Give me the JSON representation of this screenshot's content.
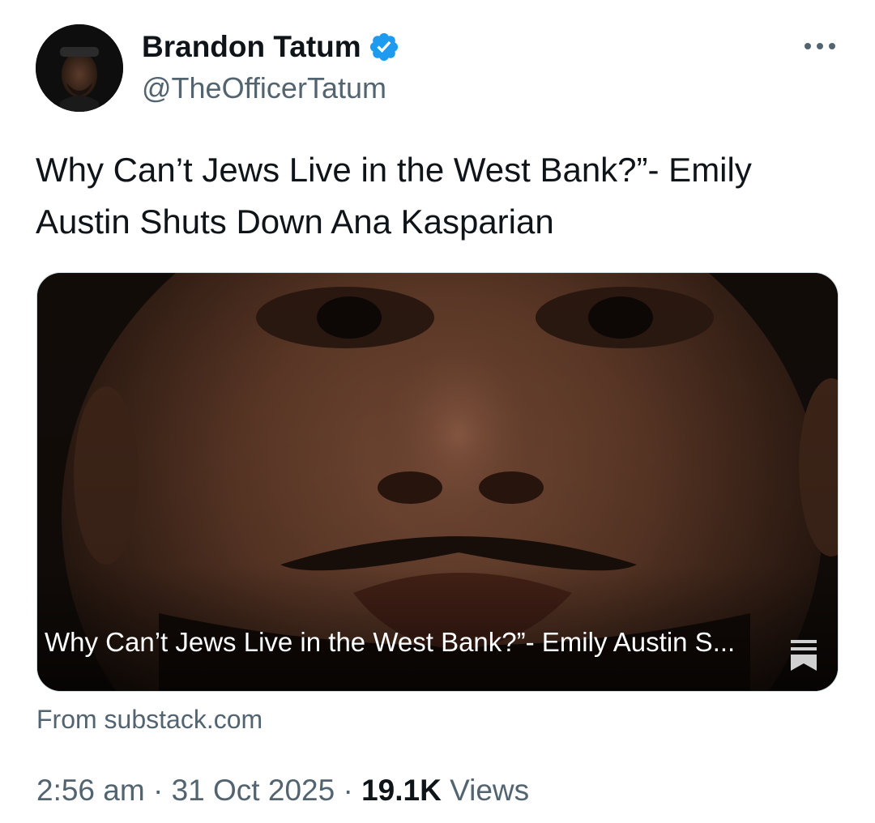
{
  "author": {
    "display_name": "Brandon Tatum",
    "handle": "@TheOfficerTatum",
    "verified_icon": "verified-badge-icon",
    "avatar_icon": "avatar"
  },
  "more_icon": "more-options-icon",
  "tweet": {
    "text": "Why Can’t Jews Live in the West Bank?”- Emily Austin Shuts Down Ana Kasparian"
  },
  "link_card": {
    "title": "Why Can’t Jews Live in the West Bank?”- Emily Austin S...",
    "source": "From substack.com",
    "publisher_icon": "substack-icon"
  },
  "meta": {
    "time": "2:56 am",
    "date": "31 Oct 2025",
    "separator": "·",
    "views_count": "19.1K",
    "views_label": "Views"
  },
  "colors": {
    "text_primary": "#0f1419",
    "text_secondary": "#536471",
    "verified": "#1d9bf0"
  }
}
